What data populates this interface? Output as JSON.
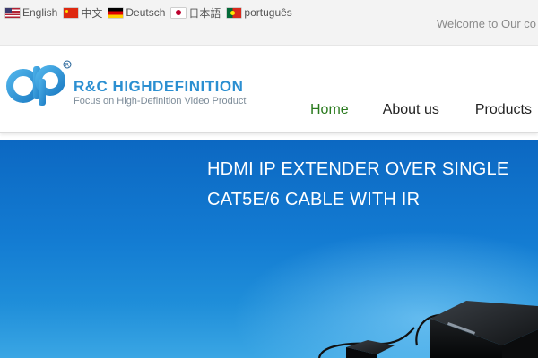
{
  "topbar": {
    "languages": [
      {
        "label": "English",
        "flag": "us-flag-icon"
      },
      {
        "label": "中文",
        "flag": "cn-flag-icon"
      },
      {
        "label": "Deutsch",
        "flag": "de-flag-icon"
      },
      {
        "label": "日本語",
        "flag": "jp-flag-icon"
      },
      {
        "label": "português",
        "flag": "pt-flag-icon"
      }
    ],
    "welcome": "Welcome to Our co"
  },
  "header": {
    "brand_name": "R&C HIGHDEFINITION",
    "brand_tagline": "Focus on High-Definition Video Product",
    "nav": [
      {
        "label": "Home",
        "active": true
      },
      {
        "label": "About us",
        "active": false
      },
      {
        "label": "Products",
        "active": false
      }
    ]
  },
  "hero": {
    "title_line1": "HDMI IP EXTENDER OVER SINGLE",
    "title_line2": "CAT5E/6 CABLE WITH IR"
  },
  "colors": {
    "brand_blue": "#2b8fd1",
    "nav_active": "#2a7a1e",
    "hero_top": "#0c68c2",
    "hero_bottom": "#3aa6e4"
  }
}
